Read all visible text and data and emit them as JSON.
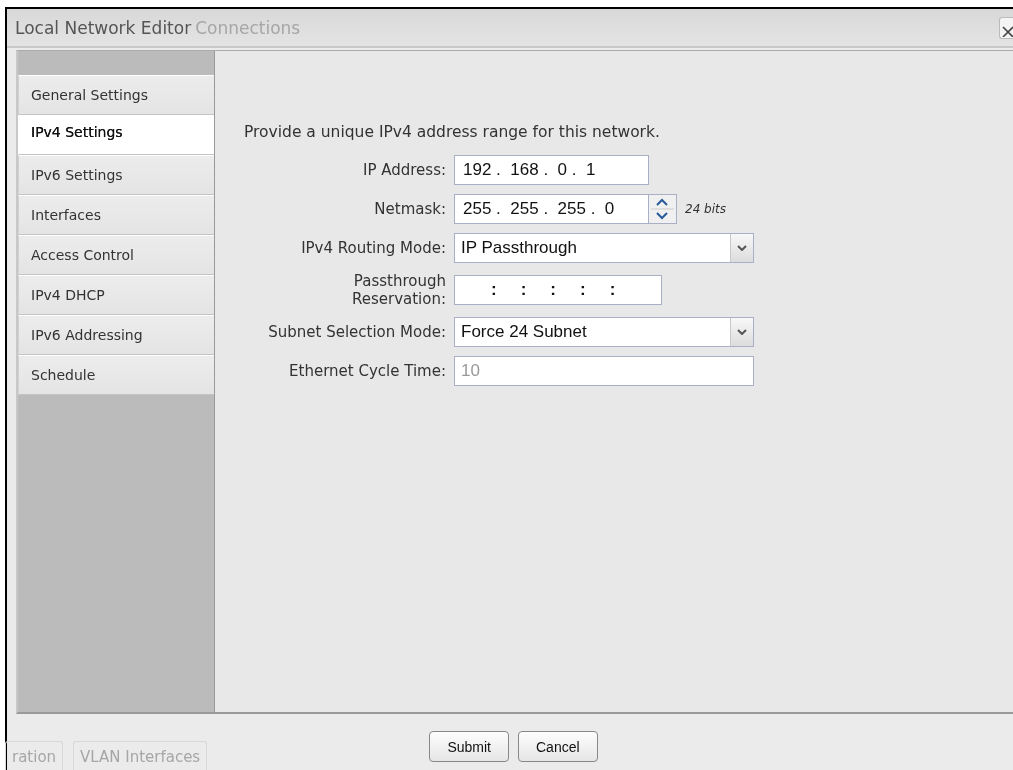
{
  "window": {
    "title": "Local Network Editor"
  },
  "background": {
    "title_text": "Connections",
    "tabs": [
      "ration",
      "VLAN Interfaces"
    ]
  },
  "tabs": [
    {
      "label": "General Settings",
      "selected": false
    },
    {
      "label": "IPv4 Settings",
      "selected": true
    },
    {
      "label": "IPv6 Settings",
      "selected": false
    },
    {
      "label": "Interfaces",
      "selected": false
    },
    {
      "label": "Access Control",
      "selected": false
    },
    {
      "label": "IPv4 DHCP",
      "selected": false
    },
    {
      "label": "IPv6 Addressing",
      "selected": false
    },
    {
      "label": "Schedule",
      "selected": false
    }
  ],
  "description": "Provide a unique IPv4 address range for this network.",
  "fields": [
    {
      "kind": "octets",
      "label": "IP Address:",
      "octets": [
        "192",
        "168",
        "0",
        "1"
      ],
      "separators": [
        ".",
        ".",
        "."
      ]
    },
    {
      "kind": "octets",
      "label": "Netmask:",
      "octets": [
        "255",
        "255",
        "255",
        "0"
      ],
      "separators": [
        ".",
        ".",
        "."
      ],
      "spinner": true,
      "note": "24 bits"
    },
    {
      "kind": "select",
      "label": "IPv4 Routing Mode:",
      "value": "IP Passthrough"
    },
    {
      "kind": "mac",
      "label": "Passthrough Reservation:",
      "separators": [
        ":",
        ":",
        ":",
        ":",
        ":"
      ]
    },
    {
      "kind": "select",
      "label": "Subnet Selection Mode:",
      "value": "Force 24 Subnet"
    },
    {
      "kind": "text",
      "label": "Ethernet Cycle Time:",
      "value": "10",
      "disabled": true
    }
  ],
  "buttons": [
    "Submit",
    "Cancel"
  ]
}
